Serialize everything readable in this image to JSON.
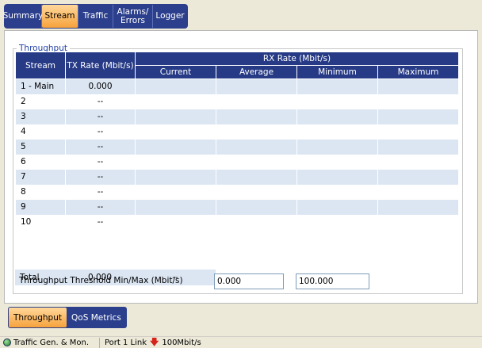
{
  "top_tabs": [
    "Summary",
    "Stream",
    "Traffic",
    "Alarms/\nErrors",
    "Logger"
  ],
  "active_top_tab": "Stream",
  "group_title": "Throughput",
  "table": {
    "header_stream": "Stream",
    "header_tx": "TX Rate (Mbit/s)",
    "header_rx": "RX Rate (Mbit/s)",
    "rx_columns": [
      "Current",
      "Average",
      "Minimum",
      "Maximum"
    ],
    "rows": [
      {
        "stream": "1 - Main",
        "tx": "0.000"
      },
      {
        "stream": "2",
        "tx": "--"
      },
      {
        "stream": "3",
        "tx": "--"
      },
      {
        "stream": "4",
        "tx": "--"
      },
      {
        "stream": "5",
        "tx": "--"
      },
      {
        "stream": "6",
        "tx": "--"
      },
      {
        "stream": "7",
        "tx": "--"
      },
      {
        "stream": "8",
        "tx": "--"
      },
      {
        "stream": "9",
        "tx": "--"
      },
      {
        "stream": "10",
        "tx": "--"
      }
    ]
  },
  "total": {
    "label": "Total",
    "tx": "0.000",
    "current": "--"
  },
  "threshold": {
    "label": "Throughput Threshold Min/Max (Mbit/s)",
    "min": "0.000",
    "max": "100.000"
  },
  "bottom_tabs": [
    "Throughput",
    "QoS Metrics"
  ],
  "active_bottom_tab": "Throughput",
  "status": {
    "mode": "Traffic Gen. & Mon.",
    "port": "Port 1 Link",
    "speed": "100Mbit/s"
  }
}
